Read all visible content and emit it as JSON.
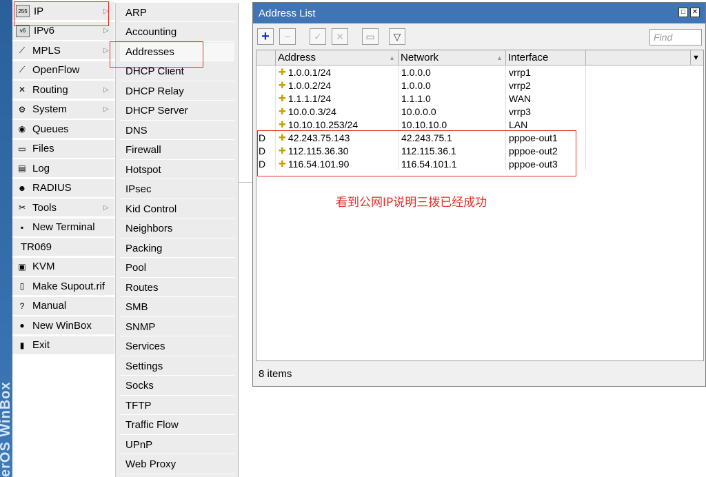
{
  "brand": {
    "vertical_text": "erOS WinBox"
  },
  "main_menu": [
    {
      "label": "IP",
      "icon": "ip-icon",
      "glyph": "255",
      "has_arrow": true
    },
    {
      "label": "IPv6",
      "icon": "ipv6-icon",
      "glyph": "v6",
      "has_arrow": true
    },
    {
      "label": "MPLS",
      "icon": "mpls-icon",
      "glyph": "⟋",
      "has_arrow": true
    },
    {
      "label": "OpenFlow",
      "icon": "openflow-icon",
      "glyph": "⟋",
      "has_arrow": false
    },
    {
      "label": "Routing",
      "icon": "routing-icon",
      "glyph": "✕",
      "has_arrow": true
    },
    {
      "label": "System",
      "icon": "system-icon",
      "glyph": "⚙",
      "has_arrow": true
    },
    {
      "label": "Queues",
      "icon": "queues-icon",
      "glyph": "◉",
      "has_arrow": false
    },
    {
      "label": "Files",
      "icon": "files-icon",
      "glyph": "▭",
      "has_arrow": false
    },
    {
      "label": "Log",
      "icon": "log-icon",
      "glyph": "▤",
      "has_arrow": false
    },
    {
      "label": "RADIUS",
      "icon": "radius-icon",
      "glyph": "☻",
      "has_arrow": false
    },
    {
      "label": "Tools",
      "icon": "tools-icon",
      "glyph": "✂",
      "has_arrow": true
    },
    {
      "label": "New Terminal",
      "icon": "terminal-icon",
      "glyph": "▪",
      "has_arrow": false
    },
    {
      "label": "TR069",
      "icon": "",
      "glyph": "",
      "has_arrow": false
    },
    {
      "label": "KVM",
      "icon": "kvm-icon",
      "glyph": "▣",
      "has_arrow": false
    },
    {
      "label": "Make Supout.rif",
      "icon": "supout-icon",
      "glyph": "▯",
      "has_arrow": false
    },
    {
      "label": "Manual",
      "icon": "manual-icon",
      "glyph": "?",
      "has_arrow": false
    },
    {
      "label": "New WinBox",
      "icon": "winbox-icon",
      "glyph": "●",
      "has_arrow": false
    },
    {
      "label": "Exit",
      "icon": "exit-icon",
      "glyph": "▮",
      "has_arrow": false
    }
  ],
  "ip_submenu": [
    "ARP",
    "Accounting",
    "Addresses",
    "DHCP Client",
    "DHCP Relay",
    "DHCP Server",
    "DNS",
    "Firewall",
    "Hotspot",
    "IPsec",
    "Kid Control",
    "Neighbors",
    "Packing",
    "Pool",
    "Routes",
    "SMB",
    "SNMP",
    "Services",
    "Settings",
    "Socks",
    "TFTP",
    "Traffic Flow",
    "UPnP",
    "Web Proxy"
  ],
  "window": {
    "title": "Address List",
    "find_placeholder": "Find",
    "columns": {
      "address": "Address",
      "network": "Network",
      "interface": "Interface"
    },
    "rows": [
      {
        "flag": "",
        "address": "1.0.0.1/24",
        "network": "1.0.0.0",
        "interface": "vrrp1"
      },
      {
        "flag": "",
        "address": "1.0.0.2/24",
        "network": "1.0.0.0",
        "interface": "vrrp2"
      },
      {
        "flag": "",
        "address": "1.1.1.1/24",
        "network": "1.1.1.0",
        "interface": "WAN"
      },
      {
        "flag": "",
        "address": "10.0.0.3/24",
        "network": "10.0.0.0",
        "interface": "vrrp3"
      },
      {
        "flag": "",
        "address": "10.10.10.253/24",
        "network": "10.10.10.0",
        "interface": "LAN"
      },
      {
        "flag": "D",
        "address": "42.243.75.143",
        "network": "42.243.75.1",
        "interface": "pppoe-out1"
      },
      {
        "flag": "D",
        "address": "112.115.36.30",
        "network": "112.115.36.1",
        "interface": "pppoe-out2"
      },
      {
        "flag": "D",
        "address": "116.54.101.90",
        "network": "116.54.101.1",
        "interface": "pppoe-out3"
      }
    ],
    "status": "8 items"
  },
  "annotation": "看到公网IP说明三拨已经成功",
  "colors": {
    "title_bar": "#3f75b5",
    "highlight_box": "#e0302a",
    "add_button": "#1030c0"
  }
}
